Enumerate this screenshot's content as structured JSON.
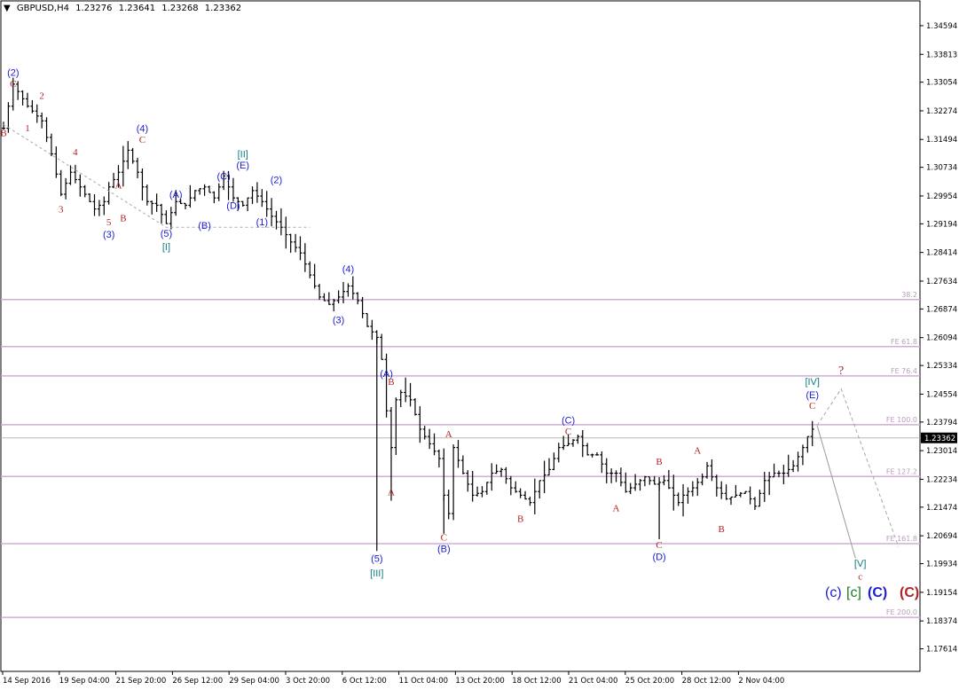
{
  "header": {
    "symbol": "GBPUSD,H4",
    "open": "1.23276",
    "high": "1.23641",
    "low": "1.23268",
    "close": "1.23362",
    "menu_icon": "triangle-down-icon"
  },
  "colors": {
    "candle": "#000000",
    "level": "#cfaed3",
    "level_text": "#b79cbb",
    "blue": "#1c1cd6",
    "red": "#b22222",
    "teal": "#0e7b80",
    "green": "#1f7a1f",
    "dashed": "#a8a8a8"
  },
  "chart_data": {
    "type": "bar",
    "title": "GBPUSD,H4",
    "ylim": [
      1.17,
      1.351
    ],
    "y_ticks": [
      "1.34594",
      "1.33813",
      "1.33054",
      "1.32274",
      "1.31494",
      "1.30734",
      "1.29954",
      "1.29194",
      "1.28414",
      "1.27634",
      "1.26874",
      "1.26094",
      "1.25334",
      "1.24554",
      "1.23794",
      "1.23014",
      "1.22234",
      "1.21474",
      "1.20694",
      "1.19934",
      "1.19154",
      "1.18374",
      "1.17614"
    ],
    "x_labels": [
      "14 Sep 2016",
      "19 Sep 04:00",
      "21 Sep 20:00",
      "26 Sep 12:00",
      "29 Sep 04:00",
      "3 Oct 20:00",
      "6 Oct 12:00",
      "11 Oct 04:00",
      "13 Oct 20:00",
      "18 Oct 12:00",
      "21 Oct 04:00",
      "25 Oct 20:00",
      "28 Oct 12:00",
      "2 Nov 04:00"
    ],
    "current_price": "1.23362",
    "levels": [
      {
        "label": "38.2",
        "price": 1.2713
      },
      {
        "label": "FE 61.8",
        "price": 1.2585
      },
      {
        "label": "FE 76.4",
        "price": 1.2505
      },
      {
        "label": "FE 100.0",
        "price": 1.2372
      },
      {
        "label": "FE 127.2",
        "price": 1.2231
      },
      {
        "label": "FE 161.8",
        "price": 1.2048
      },
      {
        "label": "FE 200.0",
        "price": 1.1847
      }
    ],
    "price_path": [
      [
        0,
        1.318
      ],
      [
        2,
        1.33
      ],
      [
        5,
        1.324
      ],
      [
        8,
        1.32
      ],
      [
        10,
        1.311
      ],
      [
        12,
        1.3
      ],
      [
        14,
        1.306
      ],
      [
        16,
        1.302
      ],
      [
        19,
        1.296
      ],
      [
        21,
        1.298
      ],
      [
        22,
        1.302
      ],
      [
        24,
        1.306
      ],
      [
        26,
        1.312
      ],
      [
        28,
        1.306
      ],
      [
        30,
        1.298
      ],
      [
        32,
        1.297
      ],
      [
        34,
        1.292
      ],
      [
        36,
        1.298
      ],
      [
        38,
        1.297
      ],
      [
        40,
        1.301
      ],
      [
        42,
        1.302
      ],
      [
        44,
        1.299
      ],
      [
        46,
        1.305
      ],
      [
        48,
        1.299
      ],
      [
        50,
        1.297
      ],
      [
        52,
        1.301
      ],
      [
        54,
        1.298
      ],
      [
        56,
        1.294
      ],
      [
        58,
        1.291
      ],
      [
        60,
        1.287
      ],
      [
        62,
        1.284
      ],
      [
        64,
        1.278
      ],
      [
        66,
        1.272
      ],
      [
        68,
        1.27
      ],
      [
        70,
        1.272
      ],
      [
        72,
        1.275
      ],
      [
        74,
        1.271
      ],
      [
        76,
        1.264
      ],
      [
        78,
        1.261
      ],
      [
        79,
        1.255
      ],
      [
        80,
        1.241
      ],
      [
        81,
        1.231
      ],
      [
        82,
        1.244
      ],
      [
        83,
        1.246
      ],
      [
        85,
        1.244
      ],
      [
        87,
        1.236
      ],
      [
        89,
        1.232
      ],
      [
        91,
        1.228
      ],
      [
        92,
        1.218
      ],
      [
        93,
        1.213
      ],
      [
        94,
        1.231
      ],
      [
        96,
        1.224
      ],
      [
        98,
        1.218
      ],
      [
        100,
        1.219
      ],
      [
        102,
        1.224
      ],
      [
        104,
        1.225
      ],
      [
        106,
        1.22
      ],
      [
        108,
        1.218
      ],
      [
        110,
        1.216
      ],
      [
        112,
        1.222
      ],
      [
        114,
        1.225
      ],
      [
        116,
        1.231
      ],
      [
        118,
        1.232
      ],
      [
        120,
        1.234
      ],
      [
        122,
        1.229
      ],
      [
        124,
        1.229
      ],
      [
        126,
        1.224
      ],
      [
        128,
        1.224
      ],
      [
        130,
        1.219
      ],
      [
        132,
        1.221
      ],
      [
        134,
        1.223
      ],
      [
        136,
        1.221
      ],
      [
        138,
        1.222
      ],
      [
        140,
        1.218
      ],
      [
        141,
        1.216
      ],
      [
        142,
        1.218
      ],
      [
        144,
        1.22
      ],
      [
        146,
        1.223
      ],
      [
        147,
        1.226
      ],
      [
        149,
        1.22
      ],
      [
        151,
        1.217
      ],
      [
        153,
        1.218
      ],
      [
        155,
        1.219
      ],
      [
        157,
        1.215
      ],
      [
        159,
        1.222
      ],
      [
        161,
        1.224
      ],
      [
        163,
        1.224
      ],
      [
        165,
        1.226
      ],
      [
        167,
        1.231
      ],
      [
        168,
        1.234
      ],
      [
        169,
        1.236
      ]
    ],
    "wave_labels": [
      {
        "text": "(2)",
        "color": "blue",
        "price": 1.3323,
        "bar": 2
      },
      {
        "text": "C",
        "color": "red",
        "price": 1.3292,
        "bar": 2
      },
      {
        "text": "2",
        "color": "red",
        "price": 1.326,
        "bar": 8
      },
      {
        "text": "B",
        "color": "red",
        "price": 1.3158,
        "bar": 0
      },
      {
        "text": "1",
        "color": "red",
        "price": 1.3172,
        "bar": 5
      },
      {
        "text": "4",
        "color": "red",
        "price": 1.3106,
        "bar": 15
      },
      {
        "text": "3",
        "color": "red",
        "price": 1.295,
        "bar": 12
      },
      {
        "text": "(4)",
        "color": "blue",
        "price": 1.317,
        "bar": 29
      },
      {
        "text": "C",
        "color": "red",
        "price": 1.314,
        "bar": 29
      },
      {
        "text": "A",
        "color": "red",
        "price": 1.3016,
        "bar": 24
      },
      {
        "text": "B",
        "color": "red",
        "price": 1.2927,
        "bar": 25
      },
      {
        "text": "5",
        "color": "red",
        "price": 1.2915,
        "bar": 22
      },
      {
        "text": "(3)",
        "color": "blue",
        "price": 1.2882,
        "bar": 22
      },
      {
        "text": "(A)",
        "color": "blue",
        "price": 1.299,
        "bar": 36
      },
      {
        "text": "(5)",
        "color": "blue",
        "price": 1.2884,
        "bar": 34
      },
      {
        "text": "[I]",
        "color": "teal",
        "price": 1.2848,
        "bar": 34
      },
      {
        "text": "(B)",
        "color": "blue",
        "price": 1.2906,
        "bar": 42
      },
      {
        "text": "(C)",
        "color": "blue",
        "price": 1.304,
        "bar": 46
      },
      {
        "text": "[II]",
        "color": "teal",
        "price": 1.31,
        "bar": 50
      },
      {
        "text": "(E)",
        "color": "blue",
        "price": 1.307,
        "bar": 50
      },
      {
        "text": "(D)",
        "color": "blue",
        "price": 1.296,
        "bar": 48
      },
      {
        "text": "(1)",
        "color": "blue",
        "price": 1.2915,
        "bar": 54
      },
      {
        "text": "(2)",
        "color": "blue",
        "price": 1.303,
        "bar": 57
      },
      {
        "text": "(4)",
        "color": "blue",
        "price": 1.2788,
        "bar": 72
      },
      {
        "text": "(3)",
        "color": "blue",
        "price": 1.2648,
        "bar": 70
      },
      {
        "text": "(A)",
        "color": "blue",
        "price": 1.2502,
        "bar": 80
      },
      {
        "text": "B",
        "color": "red",
        "price": 1.248,
        "bar": 81
      },
      {
        "text": "A",
        "color": "red",
        "price": 1.218,
        "bar": 81
      },
      {
        "text": "(5)",
        "color": "blue",
        "price": 1.1999,
        "bar": 78
      },
      {
        "text": "[III]",
        "color": "teal",
        "price": 1.1958,
        "bar": 78
      },
      {
        "text": "A",
        "color": "red",
        "price": 1.2338,
        "bar": 93
      },
      {
        "text": "C",
        "color": "red",
        "price": 1.2057,
        "bar": 92
      },
      {
        "text": "(B)",
        "color": "blue",
        "price": 1.2025,
        "bar": 92
      },
      {
        "text": "B",
        "color": "red",
        "price": 1.2107,
        "bar": 108
      },
      {
        "text": "(C)",
        "color": "blue",
        "price": 1.2375,
        "bar": 118
      },
      {
        "text": "C",
        "color": "red",
        "price": 1.2345,
        "bar": 118
      },
      {
        "text": "A",
        "color": "red",
        "price": 1.2136,
        "bar": 128
      },
      {
        "text": "B",
        "color": "red",
        "price": 1.2263,
        "bar": 137
      },
      {
        "text": "C",
        "color": "red",
        "price": 1.2036,
        "bar": 137
      },
      {
        "text": "(D)",
        "color": "blue",
        "price": 1.2003,
        "bar": 137
      },
      {
        "text": "A",
        "color": "red",
        "price": 1.2293,
        "bar": 145
      },
      {
        "text": "B",
        "color": "red",
        "price": 1.208,
        "bar": 150
      },
      {
        "text": "[IV]",
        "color": "teal",
        "price": 1.248,
        "bar": 169
      },
      {
        "text": "(E)",
        "color": "blue",
        "price": 1.2444,
        "bar": 169
      },
      {
        "text": "C",
        "color": "red",
        "price": 1.2415,
        "bar": 169
      },
      {
        "text": "?",
        "color": "red",
        "price": 1.251,
        "bar": 175
      },
      {
        "text": "[V]",
        "color": "teal",
        "price": 1.1985,
        "bar": 179
      },
      {
        "text": "c",
        "color": "red",
        "price": 1.195,
        "bar": 179
      }
    ],
    "projection_solid": [
      [
        170,
        1.237
      ],
      [
        178,
        1.2008
      ]
    ],
    "projection_dashed": [
      [
        170,
        1.237
      ],
      [
        175,
        1.247
      ],
      [
        187,
        1.204
      ]
    ],
    "guide_dashed": [
      [
        0,
        1.319
      ],
      [
        34,
        1.291
      ],
      [
        64,
        1.291
      ]
    ],
    "legend_labels": [
      {
        "text": "(c)",
        "color": "blue",
        "weight": "normal"
      },
      {
        "text": "[c]",
        "color": "green",
        "weight": "normal"
      },
      {
        "text": "(C)",
        "color": "blue",
        "weight": "bold"
      },
      {
        "text": "(C)",
        "color": "red",
        "weight": "bold"
      }
    ]
  }
}
